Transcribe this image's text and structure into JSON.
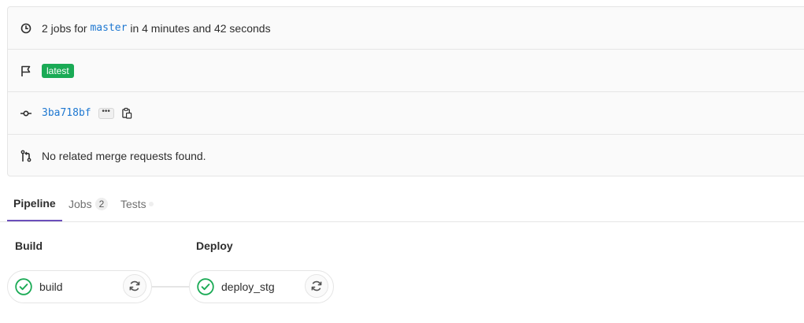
{
  "summary": {
    "jobs_prefix": "2 jobs for",
    "branch": "master",
    "duration_text": "in 4 minutes and 42 seconds",
    "tag_badge": "latest",
    "commit_sha": "3ba718bf",
    "commit_more": "•••",
    "merge_requests_text": "No related merge requests found."
  },
  "tabs": [
    {
      "label": "Pipeline",
      "active": true
    },
    {
      "label": "Jobs",
      "count": "2"
    },
    {
      "label": "Tests",
      "count": ""
    }
  ],
  "stages": [
    {
      "title": "Build",
      "job": {
        "name": "build",
        "status": "passed"
      }
    },
    {
      "title": "Deploy",
      "job": {
        "name": "deploy_stg",
        "status": "passed"
      }
    }
  ],
  "colors": {
    "success": "#1aaa55",
    "link": "#1f78d1",
    "active_tab": "#6b4fbb"
  },
  "icons": {
    "duration": "clock-icon",
    "tag": "flag-icon",
    "commit": "commit-icon",
    "copy": "clipboard-icon",
    "merge_request": "merge-request-icon",
    "status": "check-circle-icon",
    "retry": "retry-icon"
  }
}
